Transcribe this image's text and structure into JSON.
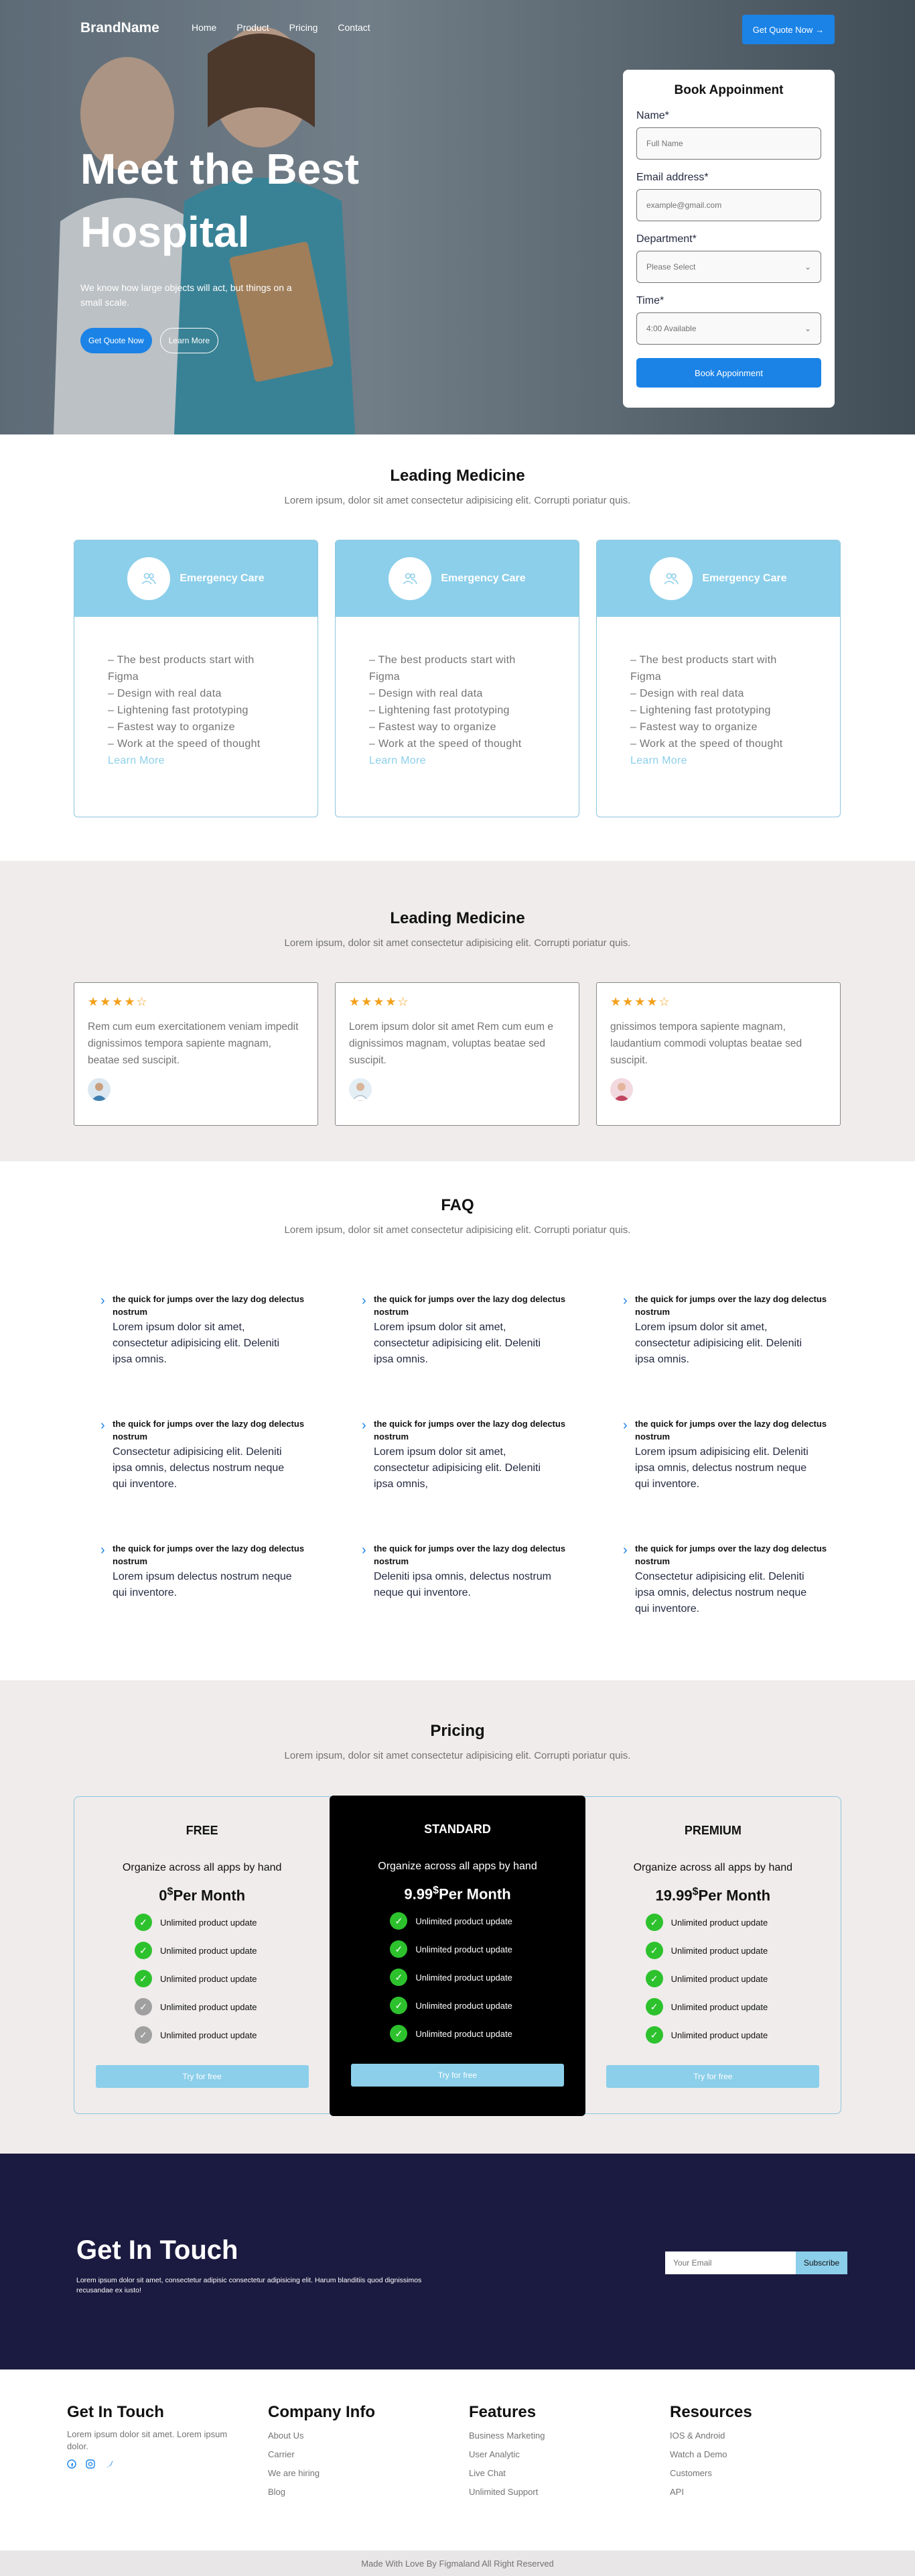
{
  "nav": {
    "brand": "BrandName",
    "links": [
      "Home",
      "Product",
      "Pricing",
      "Contact"
    ],
    "cta": "Get Quote Now",
    "cta_arrow": "→"
  },
  "hero": {
    "title": "Meet the Best Hospital",
    "description": "We know how large objects will act, but things on a small scale.",
    "primary_button": "Get Quote Now",
    "secondary_button": "Learn More"
  },
  "booking": {
    "title": "Book Appoinment",
    "name_label": "Name*",
    "name_placeholder": "Full Name",
    "email_label": "Email address*",
    "email_placeholder": "example@gmail.com",
    "department_label": "Department*",
    "department_value": "Please Select",
    "time_label": "Time*",
    "time_value": "4:00 Available",
    "submit": "Book Appoinment"
  },
  "leading": {
    "title": "Leading Medicine",
    "subtitle": "Lorem ipsum, dolor sit amet consectetur adipisicing elit. Corrupti poriatur quis.",
    "cards": [
      {
        "title": "Emergency Care",
        "lines": [
          "– The best products start with Figma",
          "– Design with real data",
          "– Lightening fast prototyping",
          "– Fastest way to organize",
          "– Work at the speed of thought"
        ],
        "link": "Learn More"
      },
      {
        "title": "Emergency Care",
        "lines": [
          "– The best products start with Figma",
          "– Design with real data",
          "– Lightening fast prototyping",
          "– Fastest way to organize",
          "– Work at the speed of thought"
        ],
        "link": "Learn More"
      },
      {
        "title": "Emergency Care",
        "lines": [
          "– The best products start with Figma",
          "– Design with real data",
          "– Lightening fast prototyping",
          "– Fastest way to organize",
          "– Work at the speed of thought"
        ],
        "link": "Learn More"
      }
    ]
  },
  "testimonials": {
    "title": "Leading Medicine",
    "subtitle": "Lorem ipsum, dolor sit amet consectetur adipisicing elit. Corrupti poriatur quis.",
    "items": [
      {
        "stars": "★★★★☆",
        "rating": 4,
        "text": "Rem cum eum exercitationem veniam impedit dignissimos tempora sapiente magnam, beatae sed suscipit."
      },
      {
        "stars": "★★★★☆",
        "rating": 4,
        "text": "Lorem ipsum dolor sit amet Rem cum eum e dignissimos magnam, voluptas beatae sed suscipit."
      },
      {
        "stars": "★★★★☆",
        "rating": 4,
        "text": "gnissimos tempora sapiente magnam, laudantium commodi voluptas beatae sed suscipit."
      }
    ]
  },
  "faq": {
    "title": "FAQ",
    "subtitle": "Lorem ipsum, dolor sit amet consectetur adipisicing elit. Corrupti poriatur quis.",
    "items": [
      {
        "q": "the quick for jumps over the lazy dog delectus nostrum",
        "a": "Lorem ipsum dolor sit amet, consectetur adipisicing elit. Deleniti ipsa omnis."
      },
      {
        "q": "the quick for jumps over the lazy dog delectus nostrum",
        "a": "Lorem ipsum dolor sit amet, consectetur adipisicing elit. Deleniti ipsa omnis."
      },
      {
        "q": "the quick for jumps over the lazy dog delectus nostrum",
        "a": "Lorem ipsum dolor sit amet, consectetur adipisicing elit. Deleniti ipsa omnis."
      },
      {
        "q": "the quick for jumps over the lazy dog delectus nostrum",
        "a": "Consectetur adipisicing elit. Deleniti ipsa omnis, delectus nostrum neque qui inventore."
      },
      {
        "q": "the quick for jumps over the lazy dog delectus nostrum",
        "a": "Lorem ipsum dolor sit amet, consectetur adipisicing elit. Deleniti ipsa omnis,"
      },
      {
        "q": "the quick for jumps over the lazy dog delectus nostrum",
        "a": "Lorem ipsum adipisicing elit. Deleniti ipsa omnis, delectus nostrum neque qui inventore."
      },
      {
        "q": "the quick for jumps over the lazy dog delectus nostrum",
        "a": "Lorem ipsum delectus nostrum neque qui inventore."
      },
      {
        "q": "the quick for jumps over the lazy dog delectus nostrum",
        "a": "Deleniti ipsa omnis, delectus nostrum neque qui inventore."
      },
      {
        "q": "the quick for jumps over the lazy dog delectus nostrum",
        "a": "Consectetur adipisicing elit. Deleniti ipsa omnis, delectus nostrum neque qui inventore."
      }
    ]
  },
  "pricing": {
    "title": "Pricing",
    "subtitle": "Lorem ipsum, dolor sit amet consectetur adipisicing elit. Corrupti poriatur quis.",
    "plans": [
      {
        "name": "FREE",
        "tagline": "Organize across all apps by hand",
        "price": "0",
        "currency": "$",
        "period": "Per Month",
        "features": [
          "Unlimited product update",
          "Unlimited product update",
          "Unlimited product update",
          "Unlimited product update",
          "Unlimited product update"
        ],
        "included": [
          true,
          true,
          true,
          false,
          false
        ],
        "button": "Try for free"
      },
      {
        "name": "STANDARD",
        "tagline": "Organize across all apps by hand",
        "price": "9.99",
        "currency": "$",
        "period": "Per Month",
        "features": [
          "Unlimited product update",
          "Unlimited product update",
          "Unlimited product update",
          "Unlimited product update",
          "Unlimited product update"
        ],
        "included": [
          true,
          true,
          true,
          true,
          true
        ],
        "button": "Try for free"
      },
      {
        "name": "PREMIUM",
        "tagline": "Organize across all apps by hand",
        "price": "19.99",
        "currency": "$",
        "period": "Per Month",
        "features": [
          "Unlimited product update",
          "Unlimited product update",
          "Unlimited product update",
          "Unlimited product update",
          "Unlimited product update"
        ],
        "included": [
          true,
          true,
          true,
          true,
          true
        ],
        "button": "Try for free"
      }
    ]
  },
  "touch": {
    "title": "Get In Touch",
    "description": "Lorem ipsum dolor sit amet, consectetur adipisic consectetur adipisicing elit. Harum blanditiis quod dignissimos recusandae ex iusto!",
    "email_placeholder": "Your Email",
    "subscribe": "Subscribe"
  },
  "footer": {
    "col1_title": "Get In Touch",
    "col1_desc": "Lorem ipsum dolor sit amet. Lorem ipsum dolor.",
    "col2_title": "Company Info",
    "col2_links": [
      "About Us",
      "Carrier",
      "We are hiring",
      "Blog"
    ],
    "col3_title": "Features",
    "col3_links": [
      "Business Marketing",
      "User Analytic",
      "Live Chat",
      "Unlimited Support"
    ],
    "col4_title": "Resources",
    "col4_links": [
      "IOS & Android",
      "Watch a Demo",
      "Customers",
      "API"
    ],
    "copyright": "Made With Love By Figmaland All Right Reserved"
  },
  "colors": {
    "primary": "#1b83e6",
    "accent_light_blue": "#8ccfea",
    "star": "#f3a01b",
    "check_green": "#2dc22d",
    "check_gray": "#a0a0a0",
    "dark_navy": "#1b1a40"
  },
  "icons": {
    "card_icon": "users-icon",
    "faq_icon": "chevron-right-icon",
    "check_icon": "check-icon",
    "social": [
      "facebook-icon",
      "instagram-icon",
      "twitter-icon"
    ]
  }
}
